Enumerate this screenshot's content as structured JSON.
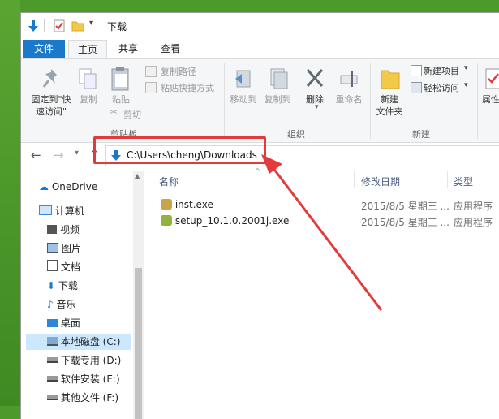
{
  "window": {
    "title": "下载"
  },
  "tabs": {
    "file": "文件",
    "home": "主页",
    "share": "共享",
    "view": "查看"
  },
  "ribbon": {
    "clipboard": {
      "label": "剪贴板",
      "pin_line1": "固定到\"快",
      "pin_line2": "速访问\"",
      "copy": "复制",
      "paste": "粘贴",
      "copy_path": "复制路径",
      "paste_shortcut": "粘贴快捷方式",
      "cut": "剪切"
    },
    "organize": {
      "label": "组织",
      "move_to": "移动到",
      "copy_to": "复制到",
      "delete": "删除",
      "rename": "重命名"
    },
    "new": {
      "label": "新建",
      "new_folder_line1": "新建",
      "new_folder_line2": "文件夹",
      "new_item": "新建项目",
      "easy_access": "轻松访问"
    },
    "open": {
      "properties": "属性"
    }
  },
  "address": {
    "path": "C:\\Users\\cheng\\Downloads"
  },
  "sidebar": {
    "items": [
      {
        "label": "OneDrive",
        "icon": "cloud-icon"
      },
      {
        "label": "计算机",
        "icon": "computer-icon"
      },
      {
        "label": "视频",
        "icon": "video-folder-icon"
      },
      {
        "label": "图片",
        "icon": "pictures-folder-icon"
      },
      {
        "label": "文档",
        "icon": "documents-folder-icon"
      },
      {
        "label": "下载",
        "icon": "download-arrow-icon"
      },
      {
        "label": "音乐",
        "icon": "music-note-icon"
      },
      {
        "label": "桌面",
        "icon": "desktop-icon"
      },
      {
        "label": "本地磁盘 (C:)",
        "icon": "windows-drive-icon"
      },
      {
        "label": "下载专用 (D:)",
        "icon": "drive-icon"
      },
      {
        "label": "软件安装 (E:)",
        "icon": "drive-icon"
      },
      {
        "label": "其他文件 (F:)",
        "icon": "drive-icon"
      }
    ]
  },
  "columns": {
    "name": "名称",
    "date": "修改日期",
    "type": "类型"
  },
  "files": [
    {
      "name": "inst.exe",
      "date": "2015/8/5 星期三 ...",
      "type": "应用程序"
    },
    {
      "name": "setup_10.1.0.2001j.exe",
      "date": "2015/8/5 星期三 ...",
      "type": "应用程序"
    }
  ],
  "colors": {
    "accent": "#1979ca",
    "annotation": "#e33b3b",
    "selected": "#cce8ff"
  }
}
